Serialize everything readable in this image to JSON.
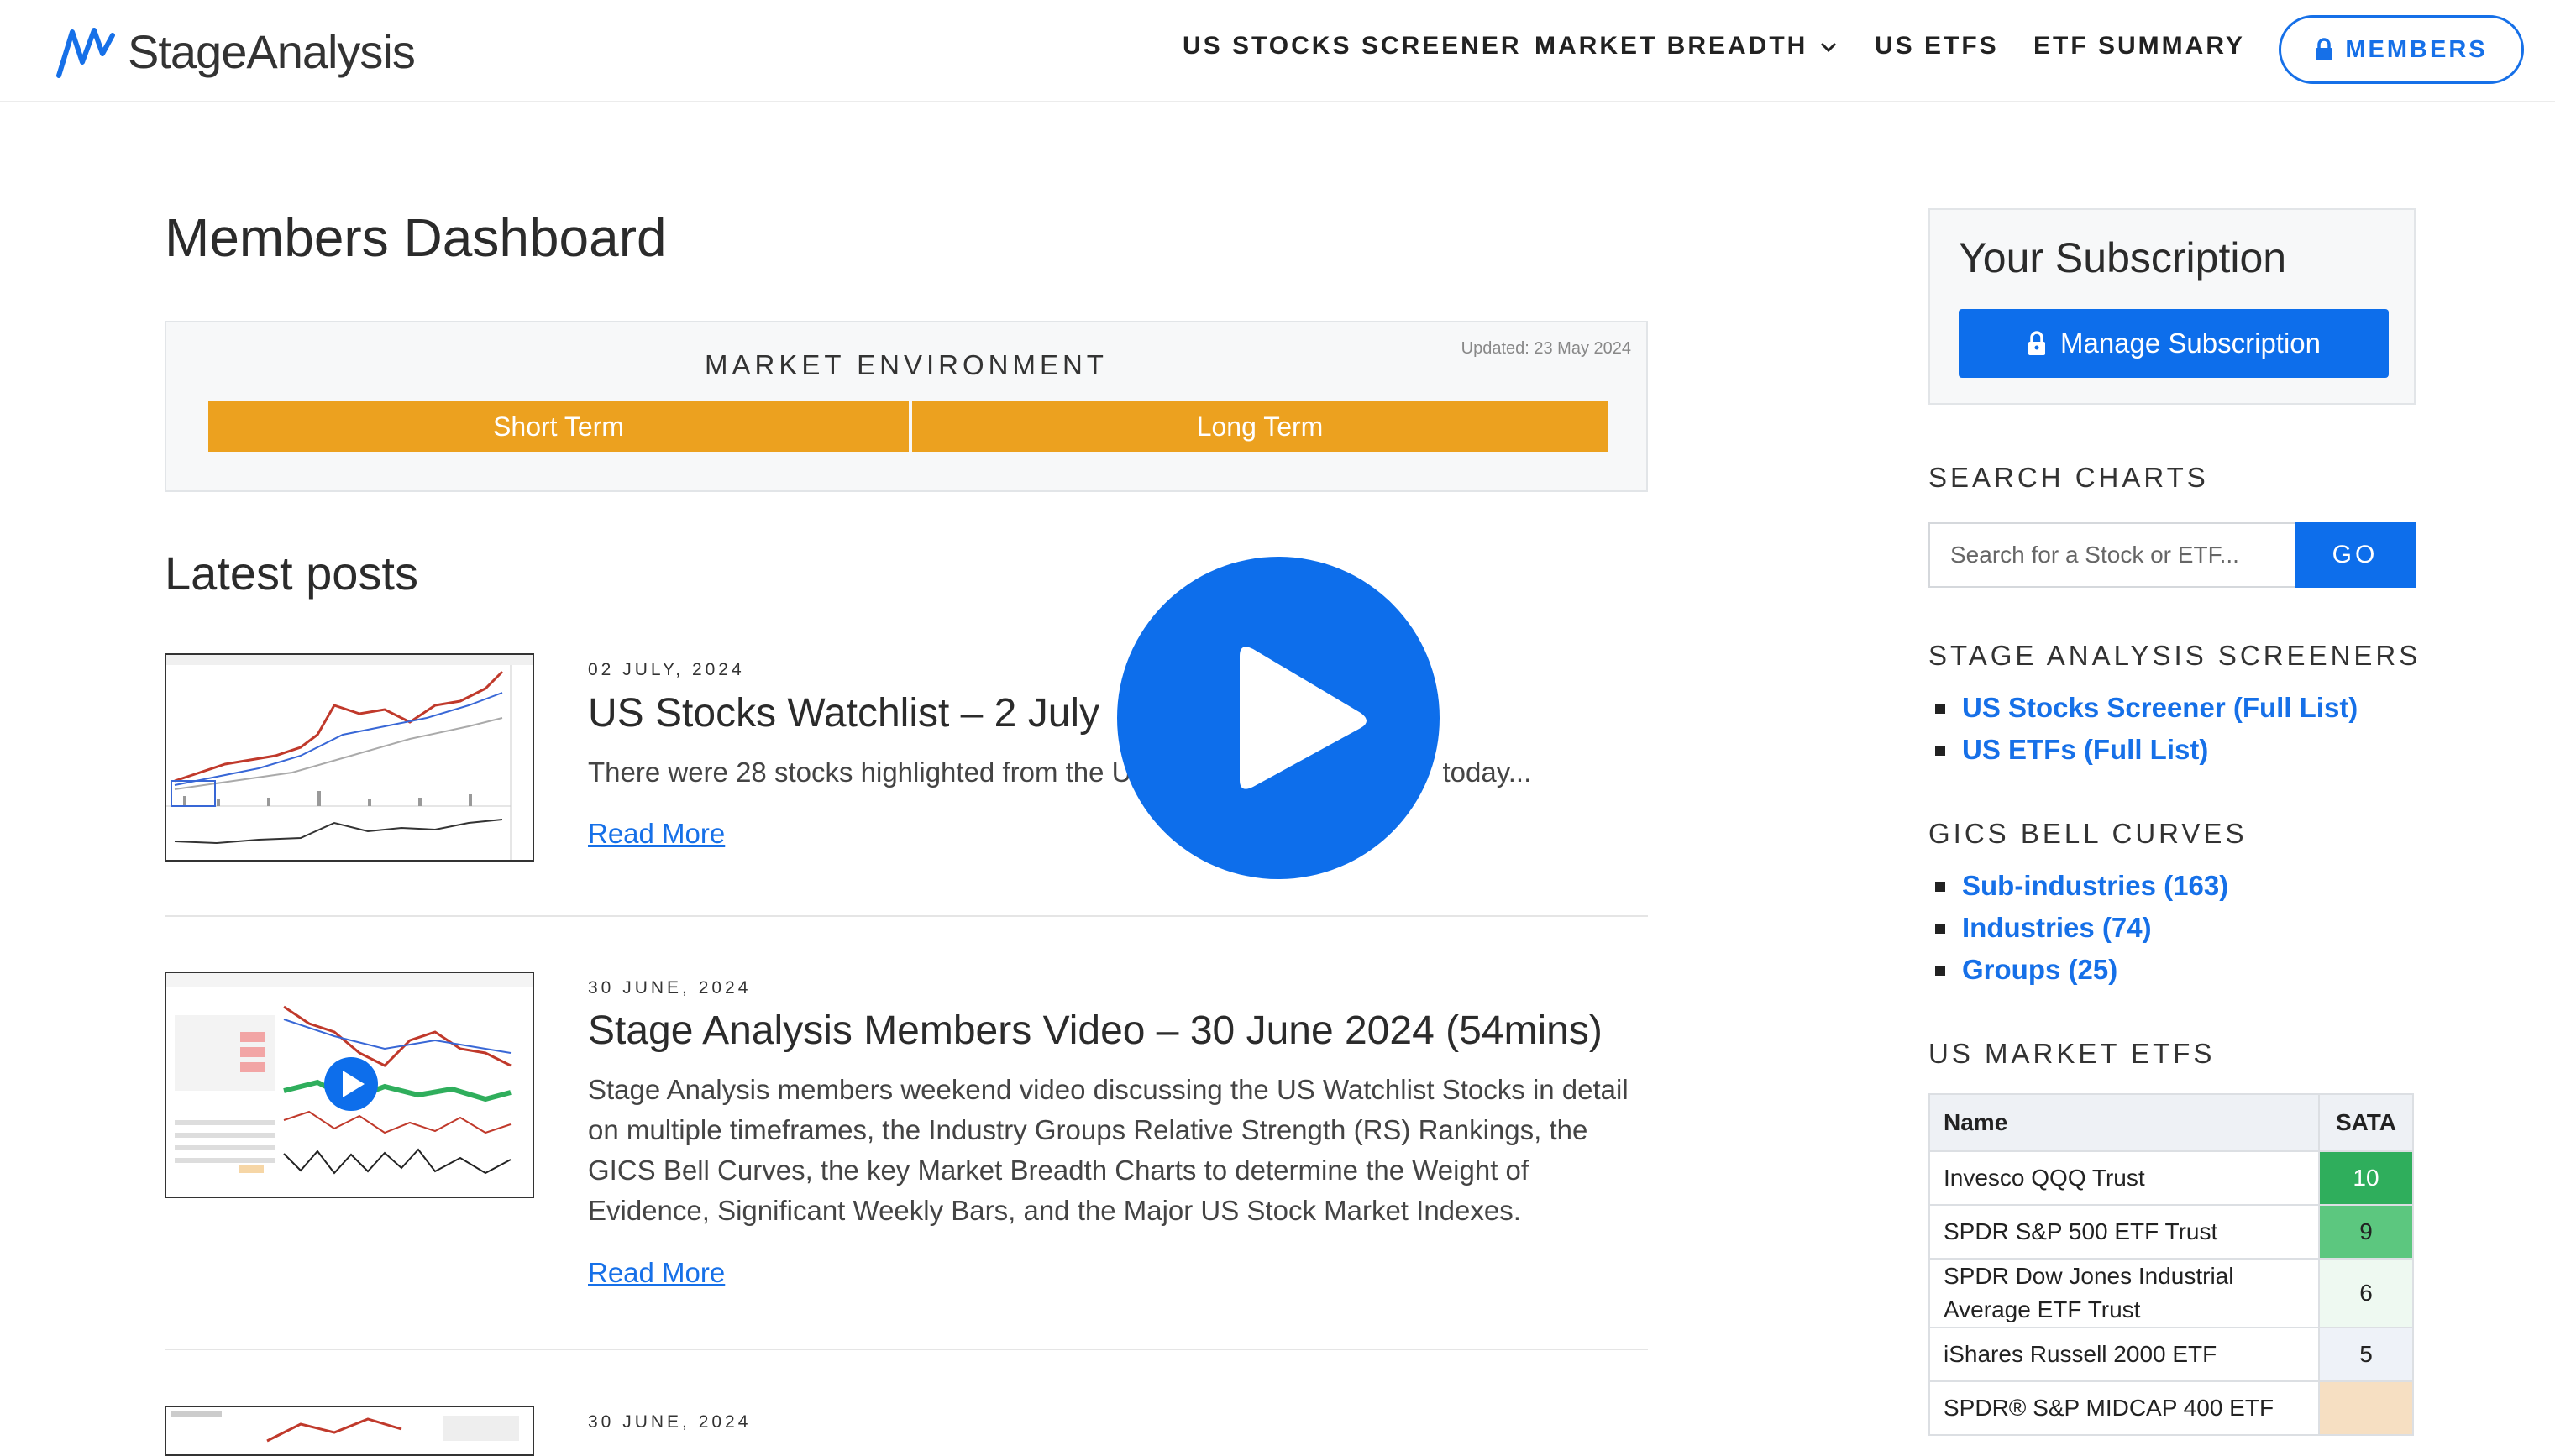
{
  "header": {
    "logo_text": "StageAnalysis",
    "nav": [
      "US STOCKS SCREENER",
      "MARKET BREADTH",
      "US ETFS",
      "ETF SUMMARY"
    ],
    "members_label": "MEMBERS"
  },
  "main": {
    "page_title": "Members Dashboard",
    "market": {
      "heading": "MARKET ENVIRONMENT",
      "updated": "Updated: 23 May 2024",
      "short_term": "Short Term",
      "long_term": "Long Term",
      "status_color": "#eca11f"
    },
    "latest_posts_title": "Latest posts",
    "posts": [
      {
        "date": "02 JULY, 2024",
        "title": "US Stocks Watchlist – 2 July",
        "excerpt": "There were 28 stocks highlighted from the U",
        "excerpt_tail": "today...",
        "read_more": "Read More"
      },
      {
        "date": "30 JUNE, 2024",
        "title": "Stage Analysis Members Video – 30 June 2024 (54mins)",
        "excerpt": "Stage Analysis members weekend video discussing the US Watchlist Stocks in detail on multiple timeframes, the Industry Groups Relative Strength (RS) Rankings, the GICS Bell Curves, the key Market Breadth Charts to determine the Weight of Evidence, Significant Weekly Bars, and the Major US Stock Market Indexes.",
        "read_more": "Read More"
      },
      {
        "date": "30 JUNE, 2024"
      }
    ]
  },
  "sidebar": {
    "subscription_title": "Your Subscription",
    "manage_label": "Manage Subscription",
    "search_heading": "SEARCH CHARTS",
    "search_placeholder": "Search for a Stock or ETF...",
    "go_label": "GO",
    "screeners_heading": "STAGE ANALYSIS SCREENERS",
    "screeners": [
      "US Stocks Screener (Full List)",
      "US ETFs (Full List)"
    ],
    "gics_heading": "GICS BELL CURVES",
    "gics": [
      "Sub-industries (163)",
      "Industries (74)",
      "Groups (25)"
    ],
    "etfs_heading": "US MARKET ETFS",
    "etf_table": {
      "headers": [
        "Name",
        "SATA"
      ],
      "rows": [
        {
          "name": "Invesco QQQ Trust",
          "sata": "10",
          "color": "#2fae5c",
          "text_color": "#ffffff"
        },
        {
          "name": "SPDR S&P 500 ETF Trust",
          "sata": "9",
          "color": "#5cc77f",
          "text_color": "#222222"
        },
        {
          "name": "SPDR Dow Jones Industrial Average ETF Trust",
          "sata": "6",
          "color": "#eef9f1",
          "text_color": "#222222"
        },
        {
          "name": "iShares Russell 2000 ETF",
          "sata": "5",
          "color": "#eef2f8",
          "text_color": "#222222"
        },
        {
          "name": "SPDR® S&P MIDCAP 400 ETF",
          "sata": "",
          "color": "#f6dfc2",
          "text_color": "#222222"
        }
      ]
    }
  }
}
